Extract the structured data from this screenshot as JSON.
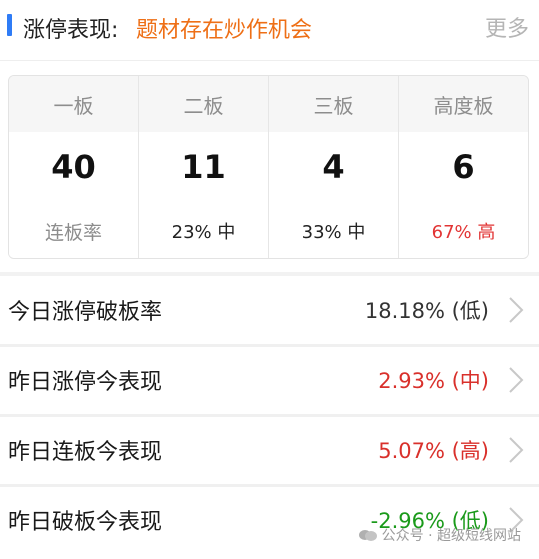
{
  "header": {
    "title": "涨停表现:",
    "subtitle": "题材存在炒作机会",
    "more_label": "更多"
  },
  "board_table": {
    "columns": [
      "一板",
      "二板",
      "三板",
      "高度板"
    ],
    "counts": [
      "40",
      "11",
      "4",
      "6"
    ],
    "rate_label": "连板率",
    "rates": [
      "23% 中",
      "33% 中",
      "67% 高"
    ]
  },
  "metrics": [
    {
      "label": "今日涨停破板率",
      "value": "18.18% (低)",
      "tone": "dark"
    },
    {
      "label": "昨日涨停今表现",
      "value": "2.93% (中)",
      "tone": "red"
    },
    {
      "label": "昨日连板今表现",
      "value": "5.07% (高)",
      "tone": "red"
    },
    {
      "label": "昨日破板今表现",
      "value": "-2.96% (低)",
      "tone": "green"
    }
  ],
  "watermark": {
    "text": "公众号 · 超级短线网站"
  },
  "colors": {
    "accent_blue": "#2f7cf6",
    "subtitle_orange": "#ee6f16",
    "positive_red": "#d9302b",
    "negative_green": "#1a9a1a",
    "muted_grey": "#8d8d8d"
  }
}
